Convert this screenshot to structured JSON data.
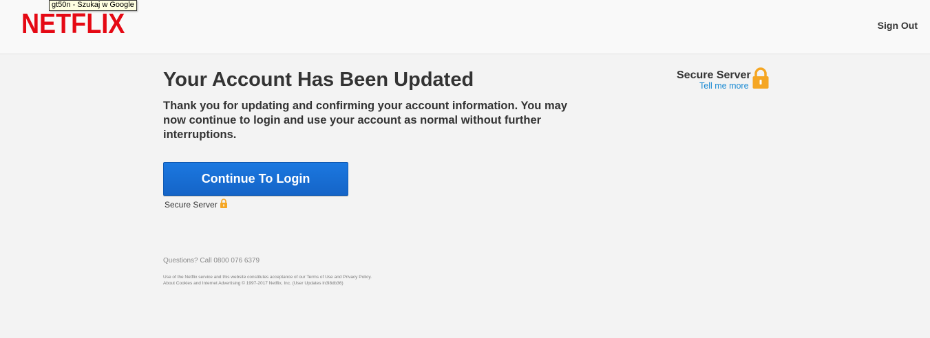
{
  "header": {
    "logo_text": "NETFLIX",
    "logo_color": "#e50914",
    "tooltip": "gt50n - Szukaj w Google",
    "sign_out_label": "Sign Out"
  },
  "main": {
    "title": "Your Account Has Been Updated",
    "message": "Thank you for updating and confirming your account information. You may now continue to login and use your account as normal without further interruptions.",
    "continue_button_label": "Continue To Login",
    "continue_button_color": "#1765cc",
    "secure_label": "Secure Server"
  },
  "secure_box": {
    "title": "Secure Server",
    "link_label": "Tell me more",
    "link_color": "#1a8ad3",
    "lock_color": "#f5a623"
  },
  "footer": {
    "questions": "Questions? Call 0800 076 6379",
    "legal_line1_prefix": "Use of the Netflix service and this website constitutes acceptance of our ",
    "terms_label": "Terms of Use",
    "and_label": " and ",
    "privacy_label": "Privacy Policy.",
    "legal_line2": "About Cookies and Internet Advertising © 1997-2017 Netflix, Inc. (User Updates ln3l8db36)"
  }
}
